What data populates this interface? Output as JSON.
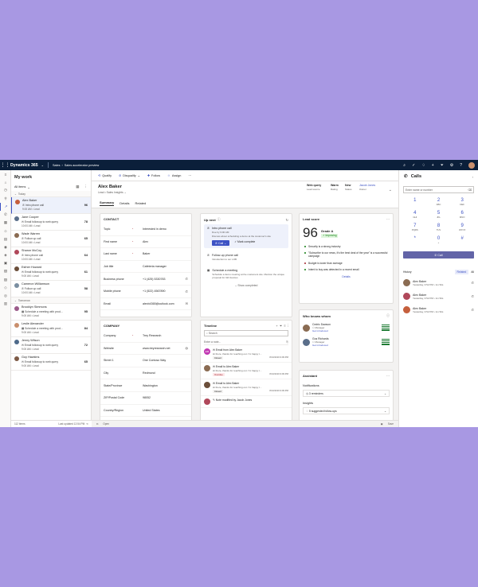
{
  "topbar": {
    "brand": "Dynamics 365",
    "app": "Sales",
    "crumb": "Sales accelerator preview"
  },
  "worklist": {
    "title": "My work",
    "filter": "All items",
    "group_today": "Today",
    "group_tomorrow": "Tomorrow",
    "items": [
      {
        "name": "Alex Baker",
        "activity": "Intro phone call",
        "meta": "9:00 AM • Lead",
        "score": "96",
        "color": "#c55f3c"
      },
      {
        "name": "Jane Cooper",
        "activity": "Email followup to web query",
        "meta": "10:00 AM • Lead",
        "score": "78",
        "color": "#5a6e8a"
      },
      {
        "name": "Wade Warren",
        "activity": "Follow up call",
        "meta": "10:00 AM • Lead",
        "score": "65",
        "color": "#8a6b52"
      },
      {
        "name": "Sharon McCoy",
        "activity": "Intro phone call",
        "meta": "10:00 AM • Lead",
        "score": "64",
        "color": "#b0485a"
      },
      {
        "name": "Esther Howard",
        "activity": "Email followup to web query",
        "meta": "9:00 AM • Lead",
        "score": "61",
        "color": "#6b4e3a"
      },
      {
        "name": "Cameron Williamson",
        "activity": "Follow up call",
        "meta": "10:00 AM • Lead",
        "score": "58",
        "color": "#7a8ea0"
      },
      {
        "name": "Brooklyn Simmons",
        "activity": "Schedule a meeting with prod...",
        "meta": "9:00 AM • Lead",
        "score": "95",
        "color": "#9b5b8a"
      },
      {
        "name": "Leslie Alexander",
        "activity": "Schedule a meeting with prod...",
        "meta": "9:00 AM • Lead",
        "score": "84",
        "color": "#c98f6d"
      },
      {
        "name": "Jenny Wilson",
        "activity": "Email followup to web query",
        "meta": "9:00 AM • Lead",
        "score": "72",
        "color": "#4e6a8a"
      },
      {
        "name": "Guy Hawkins",
        "activity": "Email followup to web query",
        "meta": "9:00 AM • Lead",
        "score": "65",
        "color": "#7d5a45"
      }
    ],
    "count": "112 items",
    "updated": "Last updated 12:54 PM"
  },
  "commands": [
    "Qualify",
    "Disqualify",
    "Follow",
    "Assign"
  ],
  "record": {
    "name": "Alex Baker",
    "subtitle": "Lead • Sales Insights",
    "header": [
      {
        "value": "Web query",
        "label": "Lead source"
      },
      {
        "value": "Warm",
        "label": "Rating"
      },
      {
        "value": "New",
        "label": "Status"
      },
      {
        "value": "Jacob Jones",
        "label": "Owner"
      }
    ],
    "tabs": [
      "Summary",
      "Details",
      "Related"
    ]
  },
  "contact": {
    "title": "CONTACT",
    "fields": [
      {
        "label": "Topic",
        "value": "Interested in demo"
      },
      {
        "label": "First name",
        "value": "Alex"
      },
      {
        "label": "Last name",
        "value": "Baker"
      },
      {
        "label": "Job title",
        "value": "Cafeteria manager"
      },
      {
        "label": "Business phone",
        "value": "+1 (425) 5330783"
      },
      {
        "label": "Mobile phone",
        "value": "+1 (522) 4567890"
      },
      {
        "label": "Email",
        "value": "alexb4365@outlook.com"
      }
    ]
  },
  "company": {
    "title": "COMPANY",
    "fields": [
      {
        "label": "Company",
        "value": "Trey Research"
      },
      {
        "label": "Website",
        "value": "www.treyresearch.net"
      },
      {
        "label": "Street 1",
        "value": "One Contoso Way"
      },
      {
        "label": "City",
        "value": "Redmond"
      },
      {
        "label": "State/Province",
        "value": "Washington"
      },
      {
        "label": "ZIP/Postal Code",
        "value": "98052"
      },
      {
        "label": "Country/Region",
        "value": "United States"
      }
    ]
  },
  "upnext": {
    "title": "Up next",
    "item1": {
      "title": "Intro phone call",
      "due": "Due by 9:00 AM",
      "desc": "Discuss about scheduling a demo at the customer's site",
      "call": "Call",
      "mark": "Mark complete"
    },
    "item2": {
      "title": "Follow-up phone call",
      "desc": "Introduction to our LOB"
    },
    "item3": {
      "title": "Schedule a meeting",
      "desc": "Schedule a demo meeting at the customers site. Mention the unique proposal for GR devices"
    },
    "show": "Show completed"
  },
  "timeline": {
    "title": "Timeline",
    "search": "Search",
    "note": "Enter a note...",
    "items": [
      {
        "title": "Email from Alex Baker",
        "sub": "Hi there, thanks for reaching out. I'm happy t...",
        "tag": "Closed",
        "date": "8/13/2019 9:09 PM",
        "initials": "EM",
        "color": "#c239b3"
      },
      {
        "title": "Email to Alex Baker",
        "sub": "Hi there, thanks for reaching out. I'm happy t...",
        "tag": "Overdue",
        "date": "8/13/2019 9:09 PM",
        "initials": "",
        "color": "#8a6b52"
      },
      {
        "title": "Email to Alex Baker",
        "sub": "Hi there, thanks for reaching out. I'm happy t...",
        "tag": "Closed",
        "date": "8/13/2019 9:09 PM",
        "initials": "",
        "color": "#6b4e3a"
      },
      {
        "title": "Note modified by Jacob Jones",
        "sub": "",
        "tag": "",
        "date": "",
        "initials": "",
        "color": "#b0485a"
      }
    ]
  },
  "leadscore": {
    "title": "Lead score",
    "score": "96",
    "grade": "Grade A",
    "trend": "Improving",
    "insights": [
      {
        "text": "Security is a strong industry",
        "color": "#107c10"
      },
      {
        "text": "\"Subscribe to our news, it's the best deal of the year\" is a successful campaign",
        "color": "#107c10"
      },
      {
        "text": "Budget is lower than average",
        "color": "#a4262c"
      },
      {
        "text": "Intent to buy was detected in a recent email",
        "color": "#107c10"
      }
    ],
    "details": "Details"
  },
  "whoknows": {
    "title": "Who knows whom",
    "people": [
      {
        "name": "Cedric Dawson",
        "role": "Manager",
        "link": "Get introduced"
      },
      {
        "name": "Gus Richards",
        "role": "Manager",
        "link": "Get introduced"
      }
    ]
  },
  "assistant": {
    "title": "Assistant",
    "notifications": "Notifications",
    "reminders": "3 reminders",
    "insights": "Insights",
    "followups": "5 suggested follow-ups"
  },
  "calls": {
    "title": "Calls",
    "placeholder": "Enter name or number",
    "keys": [
      {
        "d": "1",
        "l": ""
      },
      {
        "d": "2",
        "l": "ABC"
      },
      {
        "d": "3",
        "l": "DEF"
      },
      {
        "d": "4",
        "l": "GHI"
      },
      {
        "d": "5",
        "l": "JKL"
      },
      {
        "d": "6",
        "l": "MNO"
      },
      {
        "d": "7",
        "l": "PQRS"
      },
      {
        "d": "8",
        "l": "TUV"
      },
      {
        "d": "9",
        "l": "WXYZ"
      },
      {
        "d": "*",
        "l": ""
      },
      {
        "d": "0",
        "l": "+"
      },
      {
        "d": "#",
        "l": ""
      }
    ],
    "call": "Call",
    "history": "History",
    "tab_related": "Related",
    "tab_all": "All",
    "recent": [
      {
        "name": "Alex Baker",
        "meta": "Yesterday, 3:52 PM • 1m 52s"
      },
      {
        "name": "Alex Baker",
        "meta": "Yesterday, 3:52 PM • 1m 52s"
      },
      {
        "name": "Alex Baker",
        "meta": "Yesterday, 3:52 PM • 1m 52s"
      }
    ]
  },
  "status": {
    "open": "Open",
    "save": "Save"
  }
}
